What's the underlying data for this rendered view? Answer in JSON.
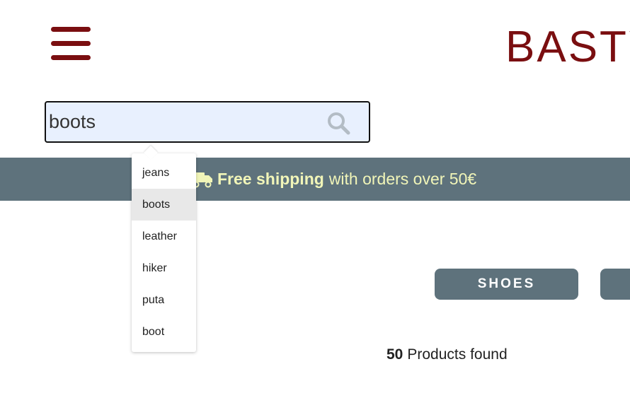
{
  "colors": {
    "brand": "#7a0e10",
    "banner_bg": "#5e727c",
    "banner_highlight": "#f1f5b8",
    "search_bg": "#e8f0fe",
    "category_bg": "#5e727c"
  },
  "header": {
    "menu_icon": "hamburger-menu-icon",
    "brand_text": "BASTY"
  },
  "search": {
    "value": "boots",
    "icon": "search-icon"
  },
  "shipping_banner": {
    "icon": "truck-icon",
    "strong_text": "Free shipping",
    "rest_text": "with orders over 50€"
  },
  "suggestions": {
    "items": [
      {
        "label": "jeans"
      },
      {
        "label": "boots",
        "selected": true
      },
      {
        "label": "leather"
      },
      {
        "label": "hiker"
      },
      {
        "label": "puta"
      },
      {
        "label": "boot"
      }
    ]
  },
  "categories": [
    {
      "label": "SHOES"
    },
    {
      "label": ""
    }
  ],
  "results": {
    "count": "50",
    "label": "Products found"
  }
}
